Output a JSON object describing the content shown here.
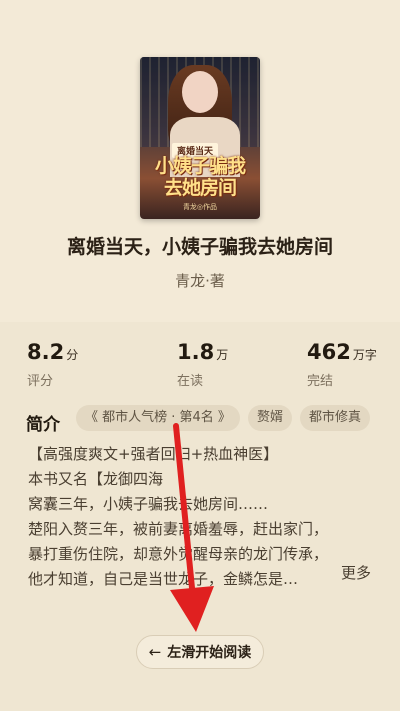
{
  "book": {
    "cover_tagline": "离婚当天",
    "cover_title": "小姨子骗我去她房间",
    "cover_author": "青龙◎作品",
    "title": "离婚当天，小姨子骗我去她房间",
    "author": "青龙·著"
  },
  "stats": [
    {
      "value": "8.2",
      "unit": "分",
      "label": "评分"
    },
    {
      "value": "1.8",
      "unit": "万",
      "label": "在读"
    },
    {
      "value": "462",
      "unit": "万字",
      "label": "完结"
    }
  ],
  "intro": {
    "heading": "简介",
    "tags": [
      "《 都市人气榜 · 第4名 》",
      "赘婿",
      "都市修真"
    ],
    "lines": [
      "【高强度爽文+强者回归+热血神医】",
      "本书又名【龙御四海",
      "窝囊三年，小姨子骗我去她房间……",
      "楚阳入赘三年，被前妻离婚羞辱，赶出家门，",
      "暴打重伤住院，却意外觉醒母亲的龙门传承，",
      "他才知道，自己是当世龙子，金鳞怎是…"
    ],
    "more": "更多"
  },
  "action": {
    "arrow": "←",
    "label": "左滑开始阅读"
  },
  "colors": {
    "background": "#efe6d2",
    "overlay_arrow": "#e02020"
  }
}
